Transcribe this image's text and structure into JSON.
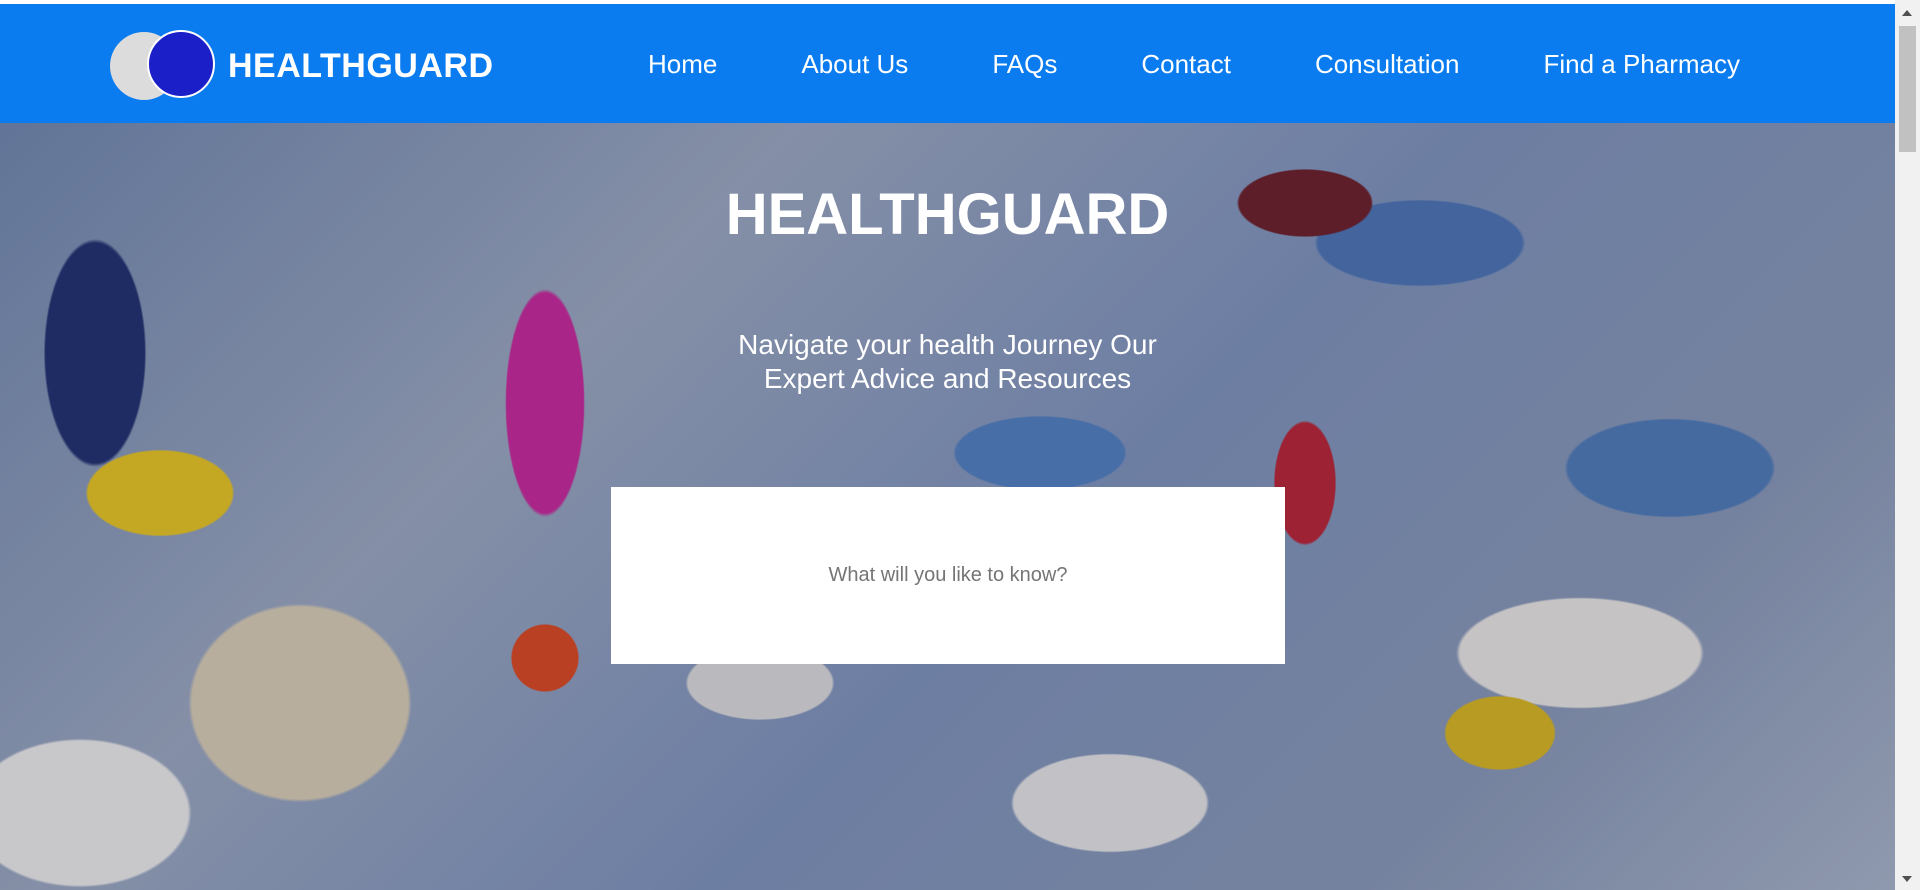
{
  "brand": {
    "name": "HEALTHGUARD",
    "logo_colors": {
      "back_circle": "#dcdcdc",
      "front_circle": "#1a1fc8"
    }
  },
  "navbar": {
    "background": "#0a7cf0",
    "items": [
      {
        "label": "Home"
      },
      {
        "label": "About Us"
      },
      {
        "label": "FAQs"
      },
      {
        "label": "Contact"
      },
      {
        "label": "Consultation"
      },
      {
        "label": "Find a Pharmacy"
      }
    ]
  },
  "hero": {
    "title": "HEALTHGUARD",
    "subtitle_line1": "Navigate your health Journey Our",
    "subtitle_line2": "Expert Advice and Resources",
    "background_image": "pills-and-capsules"
  },
  "search": {
    "placeholder": "What will you like to know?",
    "value": ""
  }
}
